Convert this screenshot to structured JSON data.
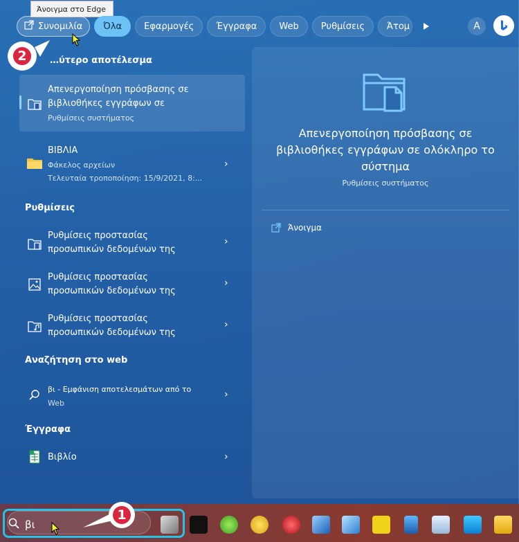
{
  "tooltip": "Άνοιγμα στο Edge",
  "filters": {
    "open_chat": "Συνομιλία",
    "all": "Όλα",
    "apps": "Εφαρμογές",
    "docs": "Έγγραφα",
    "web": "Web",
    "settings": "Ρυθμίσεις",
    "people": "Άτομ",
    "account_initial": "A",
    "more": "···"
  },
  "left": {
    "best_title": "…ύτερο αποτέλεσμα",
    "best_item": {
      "title_line1": "Απενεργοποίηση πρόσβασης σε",
      "title_line2": "βιβλιοθήκες εγγράφων σε",
      "subtitle": "Ρυθμίσεις συστήματος"
    },
    "folder_item": {
      "title": "ΒΙΒΛΙΑ",
      "sub1": "Φάκελος αρχείων",
      "sub2": "Τελευταία τροποποίηση: 15/9/2021, 8:..."
    },
    "settings_title": "Ρυθμίσεις",
    "settings_items": [
      {
        "line1": "Ρυθμίσεις προστασίας",
        "line2": "προσωπικών δεδομένων της"
      },
      {
        "line1": "Ρυθμίσεις προστασίας",
        "line2": "προσωπικών δεδομένων της"
      },
      {
        "line1": "Ρυθμίσεις προστασίας",
        "line2": "προσωπικών δεδομένων της"
      }
    ],
    "web_title": "Αναζήτηση στο web",
    "web_item": {
      "line1": "βι - Εμφάνιση αποτελεσμάτων από το",
      "line2": "Web"
    },
    "docs_title": "Έγγραφα",
    "doc_item": "Βιβλίο"
  },
  "right": {
    "title_line1": "Απενεργοποίηση πρόσβασης σε",
    "title_line2": "βιβλιοθήκες εγγράφων σε ολόκληρο το",
    "title_line3": "σύστημα",
    "subtitle": "Ρυθμίσεις συστήματος",
    "open_label": "Άνοιγμα"
  },
  "taskbar": {
    "search_value": "βι"
  },
  "badges": {
    "one": "1",
    "two": "2"
  },
  "colors": {
    "accent": "#6cc1f5",
    "badge": "#d9263e",
    "highlight": "#27c3e6"
  }
}
